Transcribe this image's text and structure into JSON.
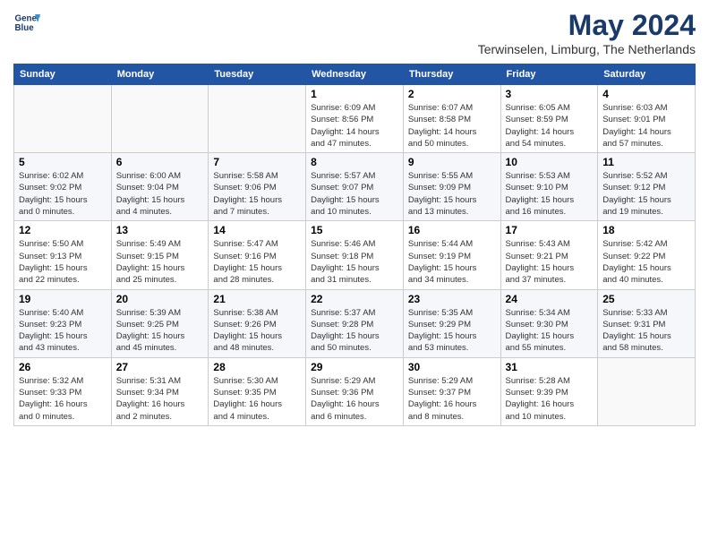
{
  "header": {
    "logo_line1": "General",
    "logo_line2": "Blue",
    "month_year": "May 2024",
    "location": "Terwinselen, Limburg, The Netherlands"
  },
  "days_of_week": [
    "Sunday",
    "Monday",
    "Tuesday",
    "Wednesday",
    "Thursday",
    "Friday",
    "Saturday"
  ],
  "weeks": [
    {
      "days": [
        {
          "num": "",
          "detail": ""
        },
        {
          "num": "",
          "detail": ""
        },
        {
          "num": "",
          "detail": ""
        },
        {
          "num": "1",
          "detail": "Sunrise: 6:09 AM\nSunset: 8:56 PM\nDaylight: 14 hours\nand 47 minutes."
        },
        {
          "num": "2",
          "detail": "Sunrise: 6:07 AM\nSunset: 8:58 PM\nDaylight: 14 hours\nand 50 minutes."
        },
        {
          "num": "3",
          "detail": "Sunrise: 6:05 AM\nSunset: 8:59 PM\nDaylight: 14 hours\nand 54 minutes."
        },
        {
          "num": "4",
          "detail": "Sunrise: 6:03 AM\nSunset: 9:01 PM\nDaylight: 14 hours\nand 57 minutes."
        }
      ]
    },
    {
      "days": [
        {
          "num": "5",
          "detail": "Sunrise: 6:02 AM\nSunset: 9:02 PM\nDaylight: 15 hours\nand 0 minutes."
        },
        {
          "num": "6",
          "detail": "Sunrise: 6:00 AM\nSunset: 9:04 PM\nDaylight: 15 hours\nand 4 minutes."
        },
        {
          "num": "7",
          "detail": "Sunrise: 5:58 AM\nSunset: 9:06 PM\nDaylight: 15 hours\nand 7 minutes."
        },
        {
          "num": "8",
          "detail": "Sunrise: 5:57 AM\nSunset: 9:07 PM\nDaylight: 15 hours\nand 10 minutes."
        },
        {
          "num": "9",
          "detail": "Sunrise: 5:55 AM\nSunset: 9:09 PM\nDaylight: 15 hours\nand 13 minutes."
        },
        {
          "num": "10",
          "detail": "Sunrise: 5:53 AM\nSunset: 9:10 PM\nDaylight: 15 hours\nand 16 minutes."
        },
        {
          "num": "11",
          "detail": "Sunrise: 5:52 AM\nSunset: 9:12 PM\nDaylight: 15 hours\nand 19 minutes."
        }
      ]
    },
    {
      "days": [
        {
          "num": "12",
          "detail": "Sunrise: 5:50 AM\nSunset: 9:13 PM\nDaylight: 15 hours\nand 22 minutes."
        },
        {
          "num": "13",
          "detail": "Sunrise: 5:49 AM\nSunset: 9:15 PM\nDaylight: 15 hours\nand 25 minutes."
        },
        {
          "num": "14",
          "detail": "Sunrise: 5:47 AM\nSunset: 9:16 PM\nDaylight: 15 hours\nand 28 minutes."
        },
        {
          "num": "15",
          "detail": "Sunrise: 5:46 AM\nSunset: 9:18 PM\nDaylight: 15 hours\nand 31 minutes."
        },
        {
          "num": "16",
          "detail": "Sunrise: 5:44 AM\nSunset: 9:19 PM\nDaylight: 15 hours\nand 34 minutes."
        },
        {
          "num": "17",
          "detail": "Sunrise: 5:43 AM\nSunset: 9:21 PM\nDaylight: 15 hours\nand 37 minutes."
        },
        {
          "num": "18",
          "detail": "Sunrise: 5:42 AM\nSunset: 9:22 PM\nDaylight: 15 hours\nand 40 minutes."
        }
      ]
    },
    {
      "days": [
        {
          "num": "19",
          "detail": "Sunrise: 5:40 AM\nSunset: 9:23 PM\nDaylight: 15 hours\nand 43 minutes."
        },
        {
          "num": "20",
          "detail": "Sunrise: 5:39 AM\nSunset: 9:25 PM\nDaylight: 15 hours\nand 45 minutes."
        },
        {
          "num": "21",
          "detail": "Sunrise: 5:38 AM\nSunset: 9:26 PM\nDaylight: 15 hours\nand 48 minutes."
        },
        {
          "num": "22",
          "detail": "Sunrise: 5:37 AM\nSunset: 9:28 PM\nDaylight: 15 hours\nand 50 minutes."
        },
        {
          "num": "23",
          "detail": "Sunrise: 5:35 AM\nSunset: 9:29 PM\nDaylight: 15 hours\nand 53 minutes."
        },
        {
          "num": "24",
          "detail": "Sunrise: 5:34 AM\nSunset: 9:30 PM\nDaylight: 15 hours\nand 55 minutes."
        },
        {
          "num": "25",
          "detail": "Sunrise: 5:33 AM\nSunset: 9:31 PM\nDaylight: 15 hours\nand 58 minutes."
        }
      ]
    },
    {
      "days": [
        {
          "num": "26",
          "detail": "Sunrise: 5:32 AM\nSunset: 9:33 PM\nDaylight: 16 hours\nand 0 minutes."
        },
        {
          "num": "27",
          "detail": "Sunrise: 5:31 AM\nSunset: 9:34 PM\nDaylight: 16 hours\nand 2 minutes."
        },
        {
          "num": "28",
          "detail": "Sunrise: 5:30 AM\nSunset: 9:35 PM\nDaylight: 16 hours\nand 4 minutes."
        },
        {
          "num": "29",
          "detail": "Sunrise: 5:29 AM\nSunset: 9:36 PM\nDaylight: 16 hours\nand 6 minutes."
        },
        {
          "num": "30",
          "detail": "Sunrise: 5:29 AM\nSunset: 9:37 PM\nDaylight: 16 hours\nand 8 minutes."
        },
        {
          "num": "31",
          "detail": "Sunrise: 5:28 AM\nSunset: 9:39 PM\nDaylight: 16 hours\nand 10 minutes."
        },
        {
          "num": "",
          "detail": ""
        }
      ]
    }
  ]
}
